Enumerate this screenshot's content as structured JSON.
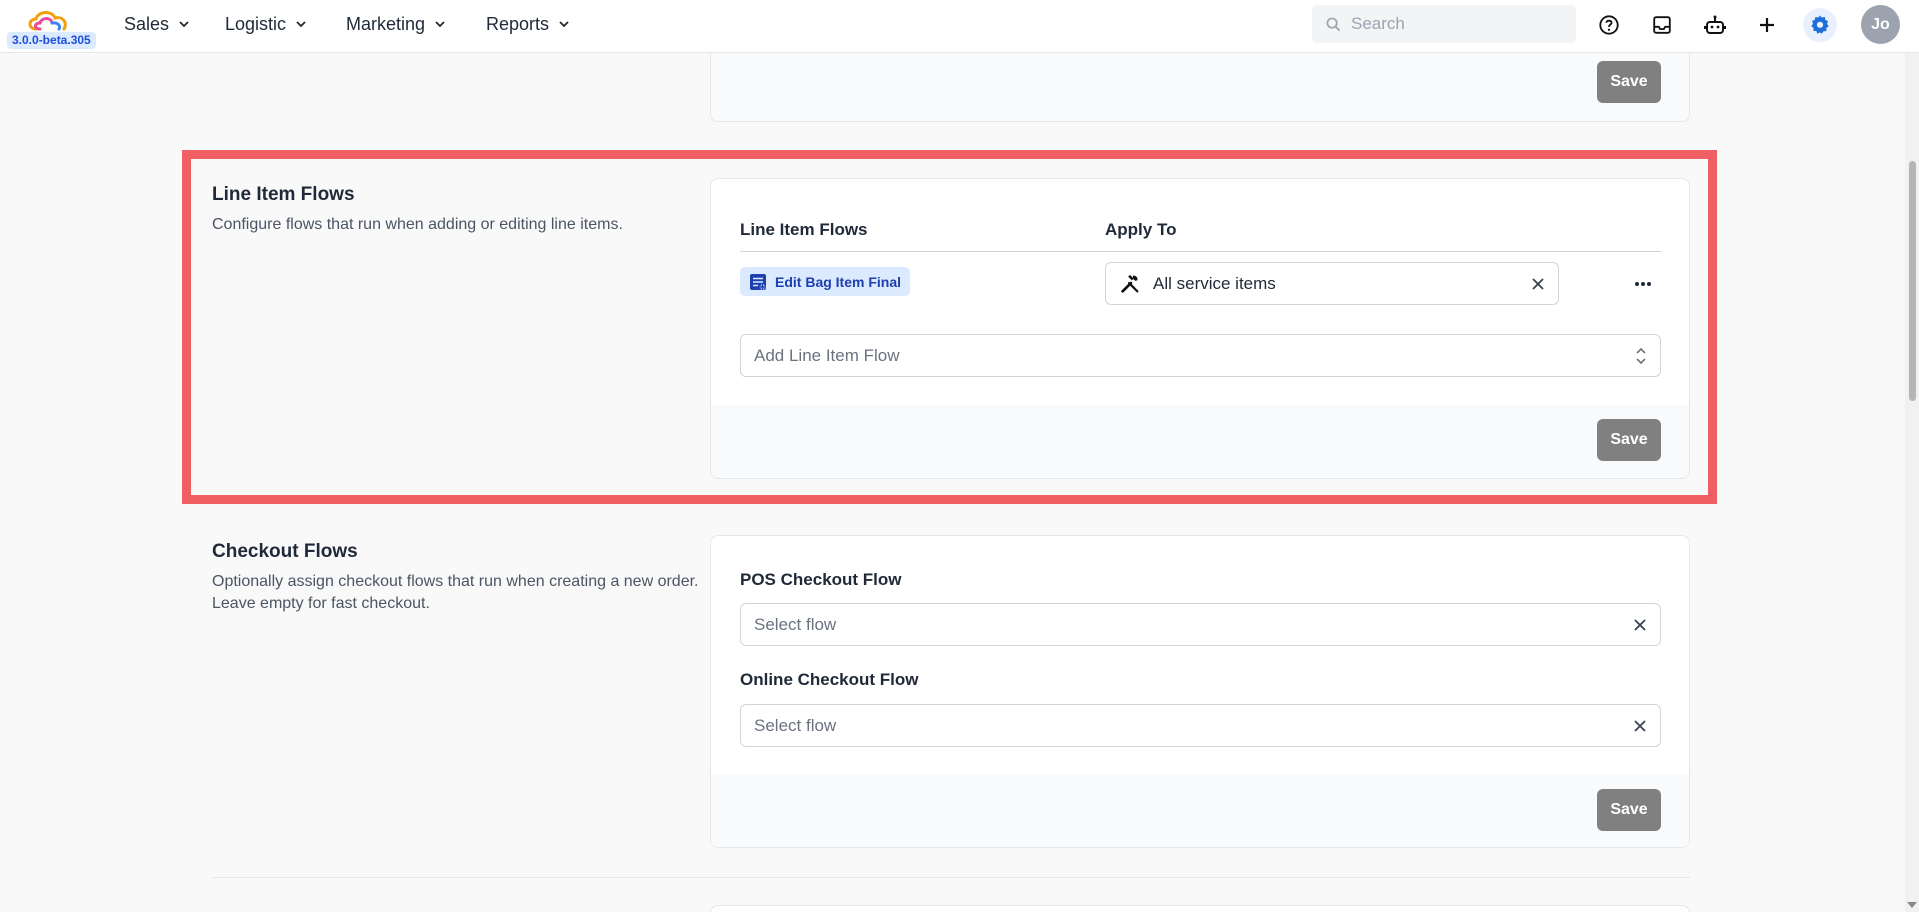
{
  "app": {
    "version": "3.0.0-beta.305"
  },
  "nav": {
    "items": [
      {
        "label": "Sales"
      },
      {
        "label": "Logistic"
      },
      {
        "label": "Marketing"
      },
      {
        "label": "Reports"
      }
    ],
    "search_placeholder": "Search",
    "avatar_initials": "Jo"
  },
  "colors": {
    "highlight": "#ef5f63",
    "accent": "#1e6fd9",
    "save_button": "#808080",
    "chip_bg": "#dbeafe"
  },
  "top_card": {
    "save_label": "Save"
  },
  "line_item_flows": {
    "title": "Line Item Flows",
    "description": "Configure flows that run when adding or editing line items.",
    "col_flows": "Line Item Flows",
    "col_apply": "Apply To",
    "rows": [
      {
        "flow": "Edit Bag Item Final",
        "apply_to": "All service items",
        "flow_icon": "playlist-add-icon",
        "apply_icon": "tools-icon"
      }
    ],
    "add_placeholder": "Add Line Item Flow",
    "save_label": "Save"
  },
  "checkout_flows": {
    "title": "Checkout Flows",
    "description": "Optionally assign checkout flows that run when creating a new order. Leave empty for fast checkout.",
    "pos_label": "POS Checkout Flow",
    "pos_placeholder": "Select flow",
    "online_label": "Online Checkout Flow",
    "online_placeholder": "Select flow",
    "save_label": "Save"
  }
}
